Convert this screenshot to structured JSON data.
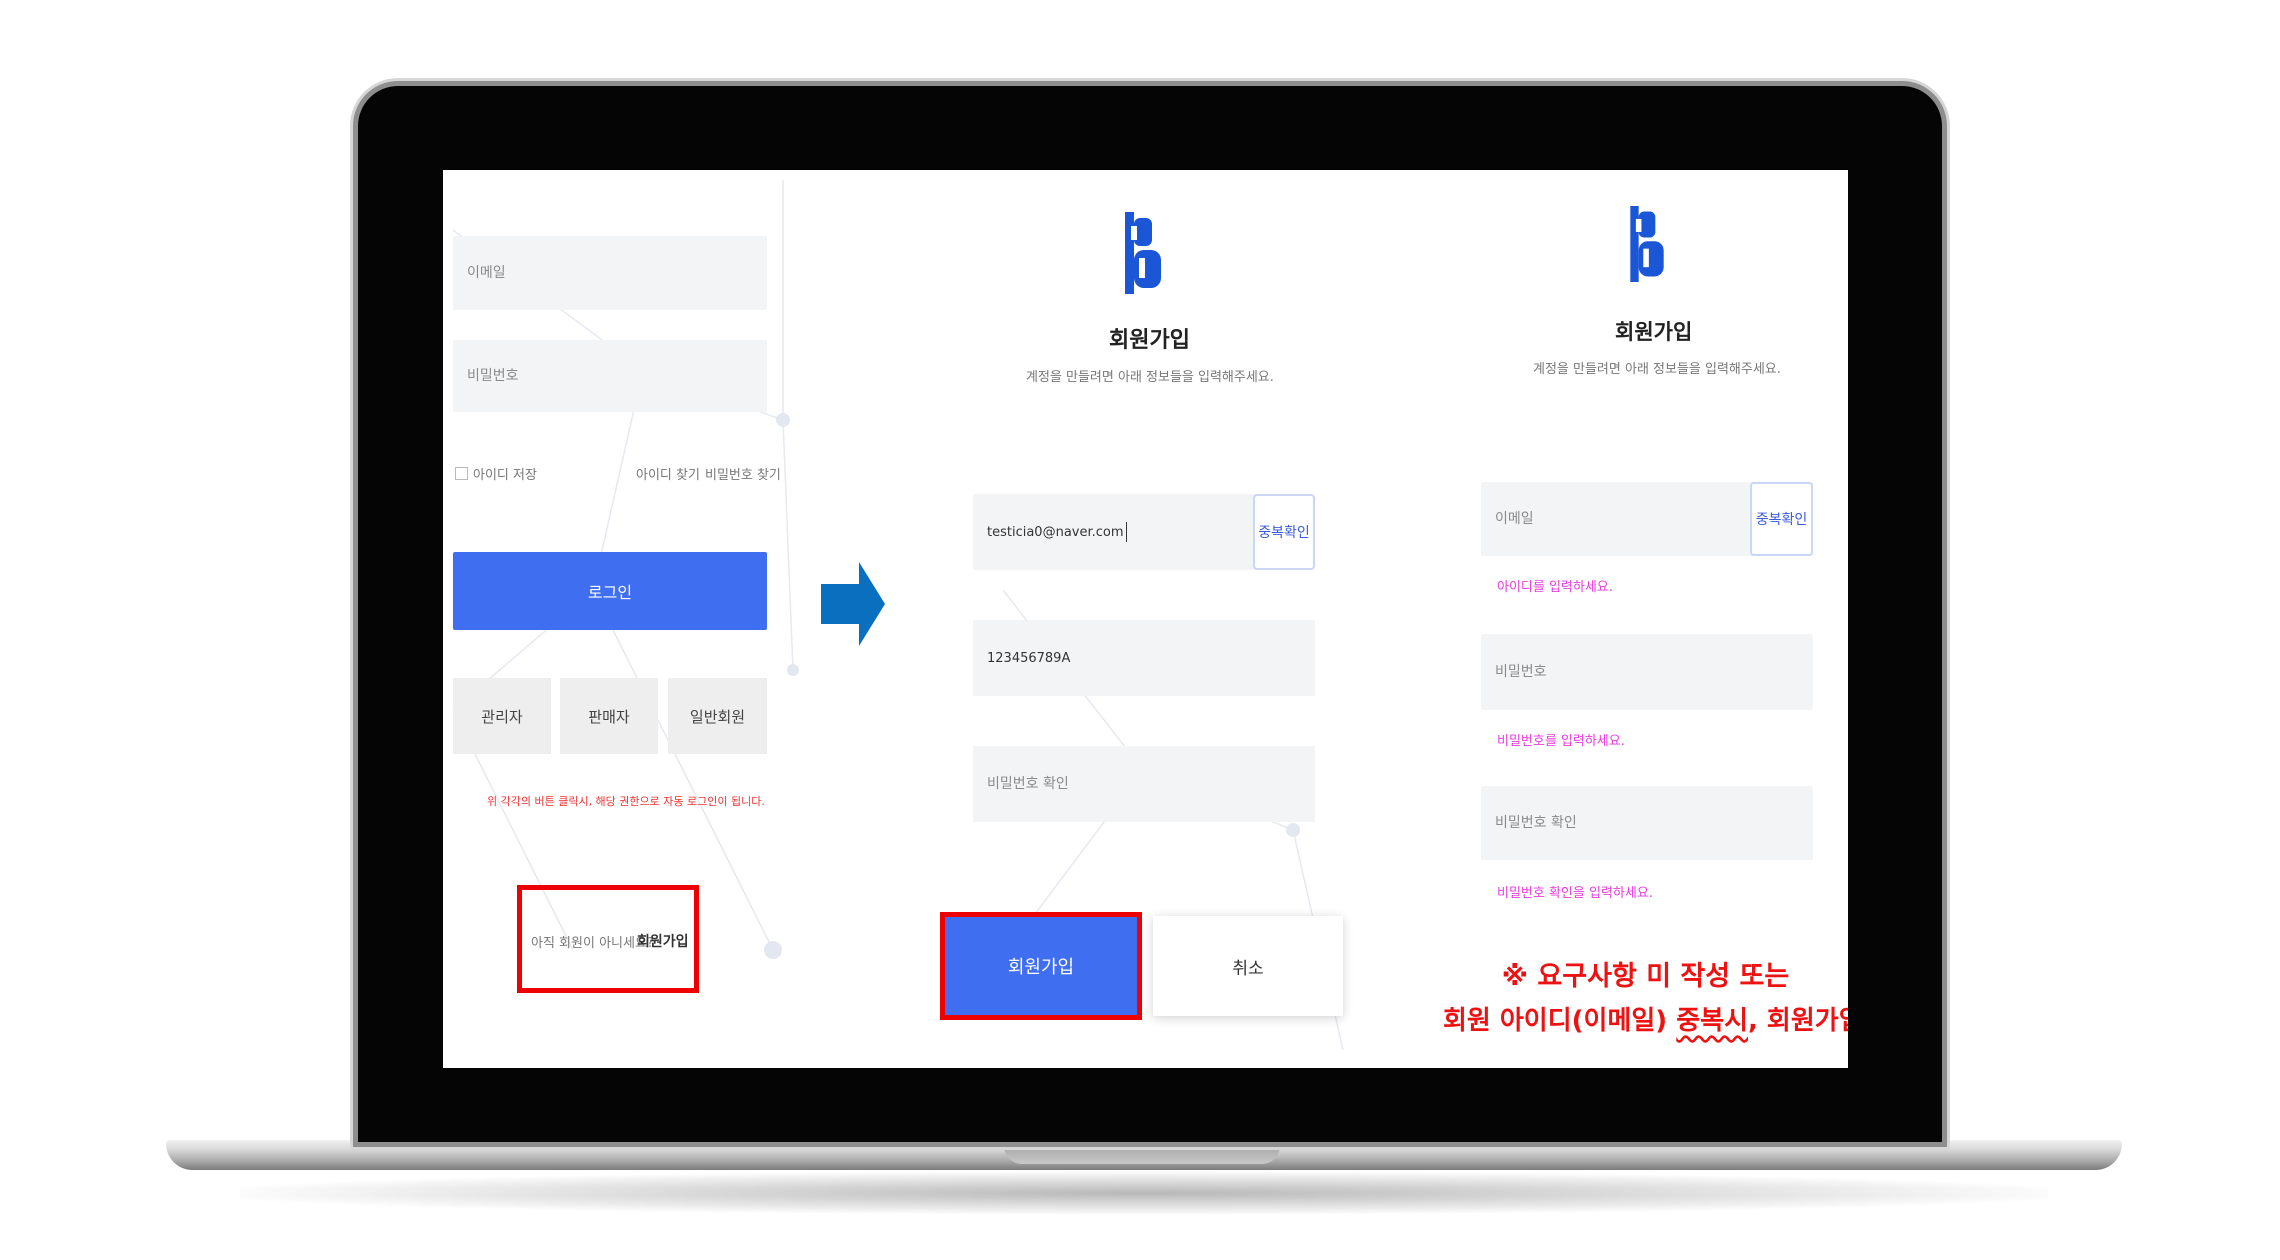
{
  "login_panel": {
    "email_placeholder": "이메일",
    "password_placeholder": "비밀번호",
    "remember_id_label": "아이디 저장",
    "find_id_link": "아이디 찾기",
    "find_password_link": "비밀번호 찾기",
    "login_button": "로그인",
    "role_buttons": [
      "관리자",
      "판매자",
      "일반회원"
    ],
    "role_notice": "위 각각의 버튼 클릭시, 해당 권한으로 자동 로그인이 됩니다.",
    "not_member_text": "아직 회원이 아니세요?",
    "signup_link": "회원가입"
  },
  "signup_panel": {
    "title": "회원가입",
    "subtitle": "계정을 만들려면 아래 정보들을 입력해주세요.",
    "email_value": "testicia0@naver.com",
    "duplicate_check_button": "중복확인",
    "password_value": "123456789A",
    "password_confirm_placeholder": "비밀번호 확인",
    "signup_button": "회원가입",
    "cancel_button": "취소"
  },
  "validation_panel": {
    "title": "회원가입",
    "subtitle": "계정을 만들려면 아래 정보들을 입력해주세요.",
    "email_placeholder": "이메일",
    "duplicate_check_button": "중복확인",
    "email_hint": "아이디를 입력하세요.",
    "password_placeholder": "비밀번호",
    "password_hint": "비밀번호를 입력하세요.",
    "password_confirm_placeholder": "비밀번호 확인",
    "password_confirm_hint": "비밀번호 확인을 입력하세요."
  },
  "notice": {
    "line1": "※ 요구사항 미 작성 또는",
    "line2_part1": "회원 아이디(이메일) ",
    "line2_underlined": "중복시",
    "line2_part2": ", 회원가입 불가"
  },
  "colors": {
    "primary_button": "#3f6ef0",
    "highlight_box": "#ee0000",
    "hint_text": "#e83adf",
    "arrow": "#0a6fbf",
    "logo": "#1a56d6"
  },
  "icons": {
    "logo": "b-logo-icon",
    "arrow": "right-arrow-icon"
  }
}
